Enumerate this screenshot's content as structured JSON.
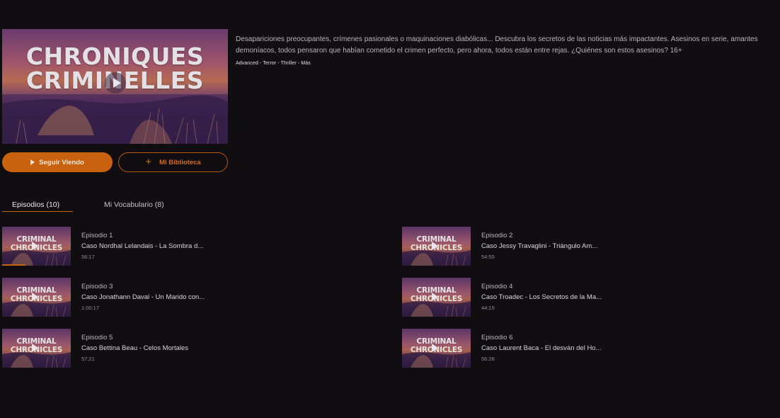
{
  "show": {
    "cover_title_line1": "CHRONIQUES",
    "cover_title_line2": "CRIMINELLES",
    "description": "Desapariciones preocupantes, crímenes pasionales o maquinaciones diabólicas... Descubra los secretos de las noticias más impactantes. Asesinos en serie, amantes demoníacos, todos pensaron que habían cometido el crimen perfecto, pero ahora, todos están entre rejas. ¿Quiénes son estos asesinos? 16+",
    "genres": "Advanced - Terror - Thriller - Más"
  },
  "actions": {
    "continue_label": "Seguir Viendo",
    "library_label": "Mi Biblioteca",
    "library_icon": "+"
  },
  "tabs": [
    {
      "label": "Episodios (10)",
      "active": true
    },
    {
      "label": "Mi Vocabulario (8)",
      "active": false
    }
  ],
  "thumbnail": {
    "title_line1": "CRIMINAL",
    "title_line2": "CHRONICLES"
  },
  "episodes": [
    {
      "number": "Episodio 1",
      "title": "Caso Nordhal Lelandais - La Sombra d...",
      "duration": "56:17",
      "progress": 0.34
    },
    {
      "number": "Episodio 2",
      "title": "Caso Jessy Travaglini - Triángulo Am...",
      "duration": "54:55",
      "progress": 0
    },
    {
      "number": "Episodio 3",
      "title": "Caso Jonathann Daval - Un Marido con...",
      "duration": "1:00:17",
      "progress": 0
    },
    {
      "number": "Episodio 4",
      "title": "Caso Troadec - Los Secretos de la Ma...",
      "duration": "44:15",
      "progress": 0
    },
    {
      "number": "Episodio 5",
      "title": "Caso Bettina Beau - Celos Mortales",
      "duration": "57:21",
      "progress": 0
    },
    {
      "number": "Episodio 6",
      "title": "Caso Laurent Baca - El desván del Ho...",
      "duration": "56:28",
      "progress": 0
    }
  ],
  "colors": {
    "accent": "#c9620f",
    "background": "#100e10"
  }
}
